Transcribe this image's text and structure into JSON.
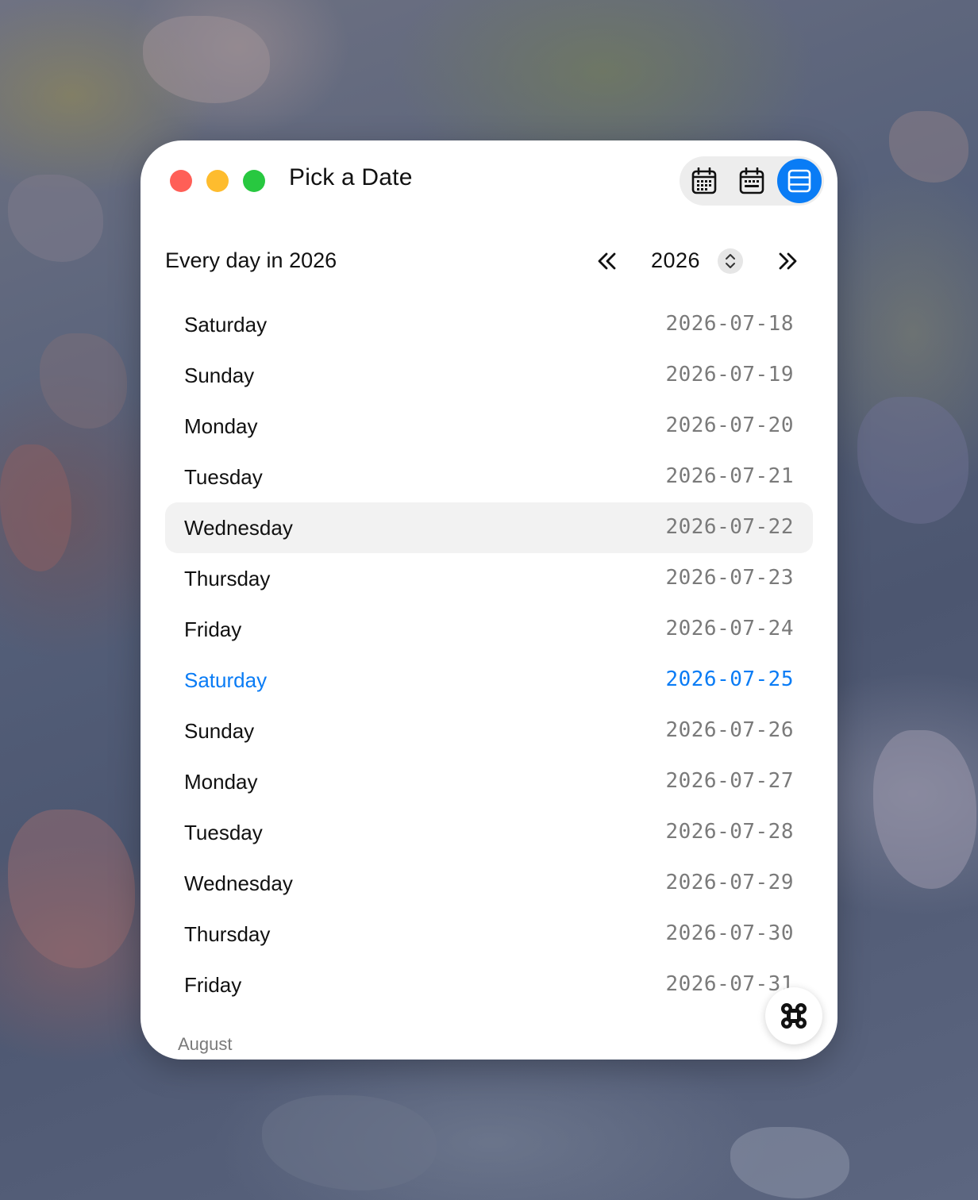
{
  "window": {
    "title": "Pick a Date"
  },
  "view_switch": {
    "options": [
      {
        "icon": "calendar-grid-icon",
        "selected": false
      },
      {
        "icon": "calendar-week-icon",
        "selected": false
      },
      {
        "icon": "list-view-icon",
        "selected": true
      }
    ],
    "accent": "#0a7cf5"
  },
  "header": {
    "heading": "Every day in 2026",
    "year": "2026",
    "prev_icon": "double-chevron-left-icon",
    "next_icon": "double-chevron-right-icon",
    "stepper_icon": "up-down-chevron-icon"
  },
  "days": [
    {
      "name": "Saturday",
      "date": "2026-07-18"
    },
    {
      "name": "Sunday",
      "date": "2026-07-19"
    },
    {
      "name": "Monday",
      "date": "2026-07-20"
    },
    {
      "name": "Tuesday",
      "date": "2026-07-21"
    },
    {
      "name": "Wednesday",
      "date": "2026-07-22",
      "state": "hover"
    },
    {
      "name": "Thursday",
      "date": "2026-07-23"
    },
    {
      "name": "Friday",
      "date": "2026-07-24"
    },
    {
      "name": "Saturday",
      "date": "2026-07-25",
      "state": "today"
    },
    {
      "name": "Sunday",
      "date": "2026-07-26"
    },
    {
      "name": "Monday",
      "date": "2026-07-27"
    },
    {
      "name": "Tuesday",
      "date": "2026-07-28"
    },
    {
      "name": "Wednesday",
      "date": "2026-07-29"
    },
    {
      "name": "Thursday",
      "date": "2026-07-30"
    },
    {
      "name": "Friday",
      "date": "2026-07-31"
    }
  ],
  "next_section": "August",
  "fab_icon": "command-icon",
  "colors": {
    "today": "#0a7cf5",
    "close": "#ff5f57",
    "minimize": "#febc2e",
    "maximize": "#28c840"
  }
}
